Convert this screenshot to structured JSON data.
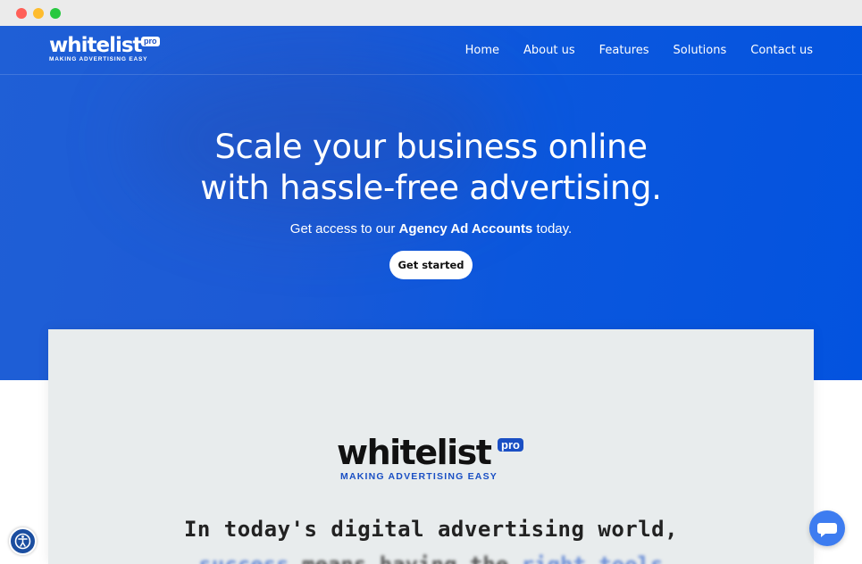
{
  "nav": {
    "logo_word": "whitelist",
    "logo_pro": "pro",
    "logo_tagline": "MAKING ADVERTISING EASY",
    "links": [
      "Home",
      "About us",
      "Features",
      "Solutions",
      "Contact us"
    ]
  },
  "hero": {
    "headline_line1": "Scale your business online",
    "headline_line2": "with hassle-free advertising.",
    "sub_before": "Get access to our ",
    "sub_bold": "Agency Ad Accounts",
    "sub_after": " today.",
    "cta_label": "Get started"
  },
  "card": {
    "logo_word": "whitelist",
    "logo_pro": "pro",
    "logo_tagline": "MAKING ADVERTISING EASY",
    "heading": "In today's digital advertising world,",
    "line2_a": "success",
    "line2_b": " means having the ",
    "line2_c": "right tools"
  },
  "icons": {
    "accessibility": "accessibility-icon",
    "chat": "chat-bubble-icon"
  },
  "colors": {
    "hero_bg": "#0353df",
    "brand_blue": "#1a4fc4",
    "chat_button": "#3d7cf0"
  }
}
